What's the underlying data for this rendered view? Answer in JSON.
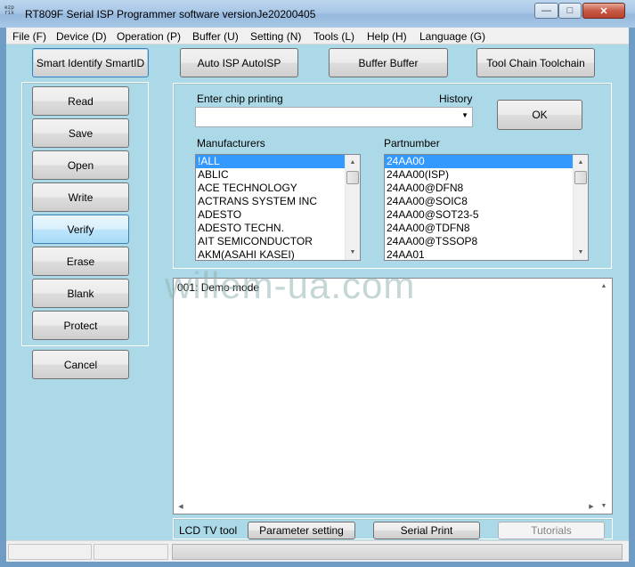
{
  "window": {
    "icon_text": "ezp rix",
    "title": "RT809F Serial ISP Programmer software versionJe20200405",
    "minimize_glyph": "—",
    "maximize_glyph": "□",
    "close_glyph": "✕"
  },
  "menu": [
    {
      "label": "File (F)"
    },
    {
      "label": "Device (D)"
    },
    {
      "label": "Operation (P)"
    },
    {
      "label": "Buffer (U)"
    },
    {
      "label": "Setting (N)"
    },
    {
      "label": "Tools (L)"
    },
    {
      "label": "Help (H)"
    },
    {
      "label": "Language (G)"
    }
  ],
  "top_buttons": {
    "smart_identify": "Smart Identify SmartID",
    "auto_isp": "Auto ISP AutoISP",
    "buffer": "Buffer Buffer",
    "tool_chain": "Tool Chain Toolchain"
  },
  "operations": {
    "read": "Read",
    "save": "Save",
    "open": "Open",
    "write": "Write",
    "verify": "Verify",
    "erase": "Erase",
    "blank": "Blank",
    "protect": "Protect",
    "cancel": "Cancel"
  },
  "chip": {
    "enter_label": "Enter chip printing",
    "history_label": "History",
    "input_value": "",
    "ok_label": "OK"
  },
  "manufacturers": {
    "label": "Manufacturers",
    "items": [
      "!ALL",
      "ABLIC",
      "ACE TECHNOLOGY",
      "ACTRANS SYSTEM INC",
      "ADESTO",
      "ADESTO TECHN.",
      "AIT SEMICONDUCTOR",
      "AKM(ASAHI KASEI)"
    ],
    "selected": "!ALL"
  },
  "partnumbers": {
    "label": "Partnumber",
    "items": [
      "24AA00",
      "24AA00(ISP)",
      "24AA00@DFN8",
      "24AA00@SOIC8",
      "24AA00@SOT23-5",
      "24AA00@TDFN8",
      "24AA00@TSSOP8",
      "24AA01"
    ],
    "selected": "24AA00"
  },
  "log": {
    "lines": [
      "001:  Demo mode"
    ],
    "watermark": "willem-ua.com"
  },
  "bottom_tools": {
    "lcd_label": "LCD TV tool",
    "parameter_setting": "Parameter setting",
    "serial_print": "Serial Print",
    "tutorials": "Tutorials"
  }
}
